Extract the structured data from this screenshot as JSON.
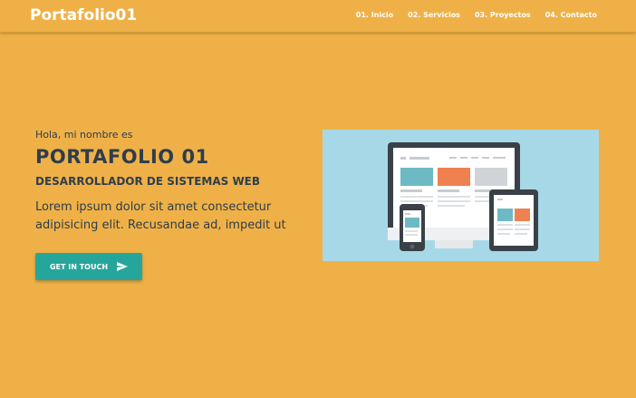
{
  "brand": "Portafolio01",
  "nav": [
    "01. Inicio",
    "02. Servicios",
    "03. Proyectos",
    "04. Contacto"
  ],
  "hero": {
    "greeting": "Hola, mi nombre es",
    "title": "PORTAFOLIO 01",
    "subtitle": "DESARROLLADOR DE SISTEMAS WEB",
    "description": "Lorem ipsum dolor sit amet consectetur adipisicing elit. Recusandae ad, impedit ut",
    "cta_label": "GET IN TOUCH",
    "cta_icon": "send-icon"
  },
  "illustration": {
    "icon": "responsive-devices-illustration"
  },
  "colors": {
    "background": "#efb147",
    "text": "#2f3d4c",
    "accent": "#26a69a",
    "illustration_bg": "#a7d8e7"
  }
}
